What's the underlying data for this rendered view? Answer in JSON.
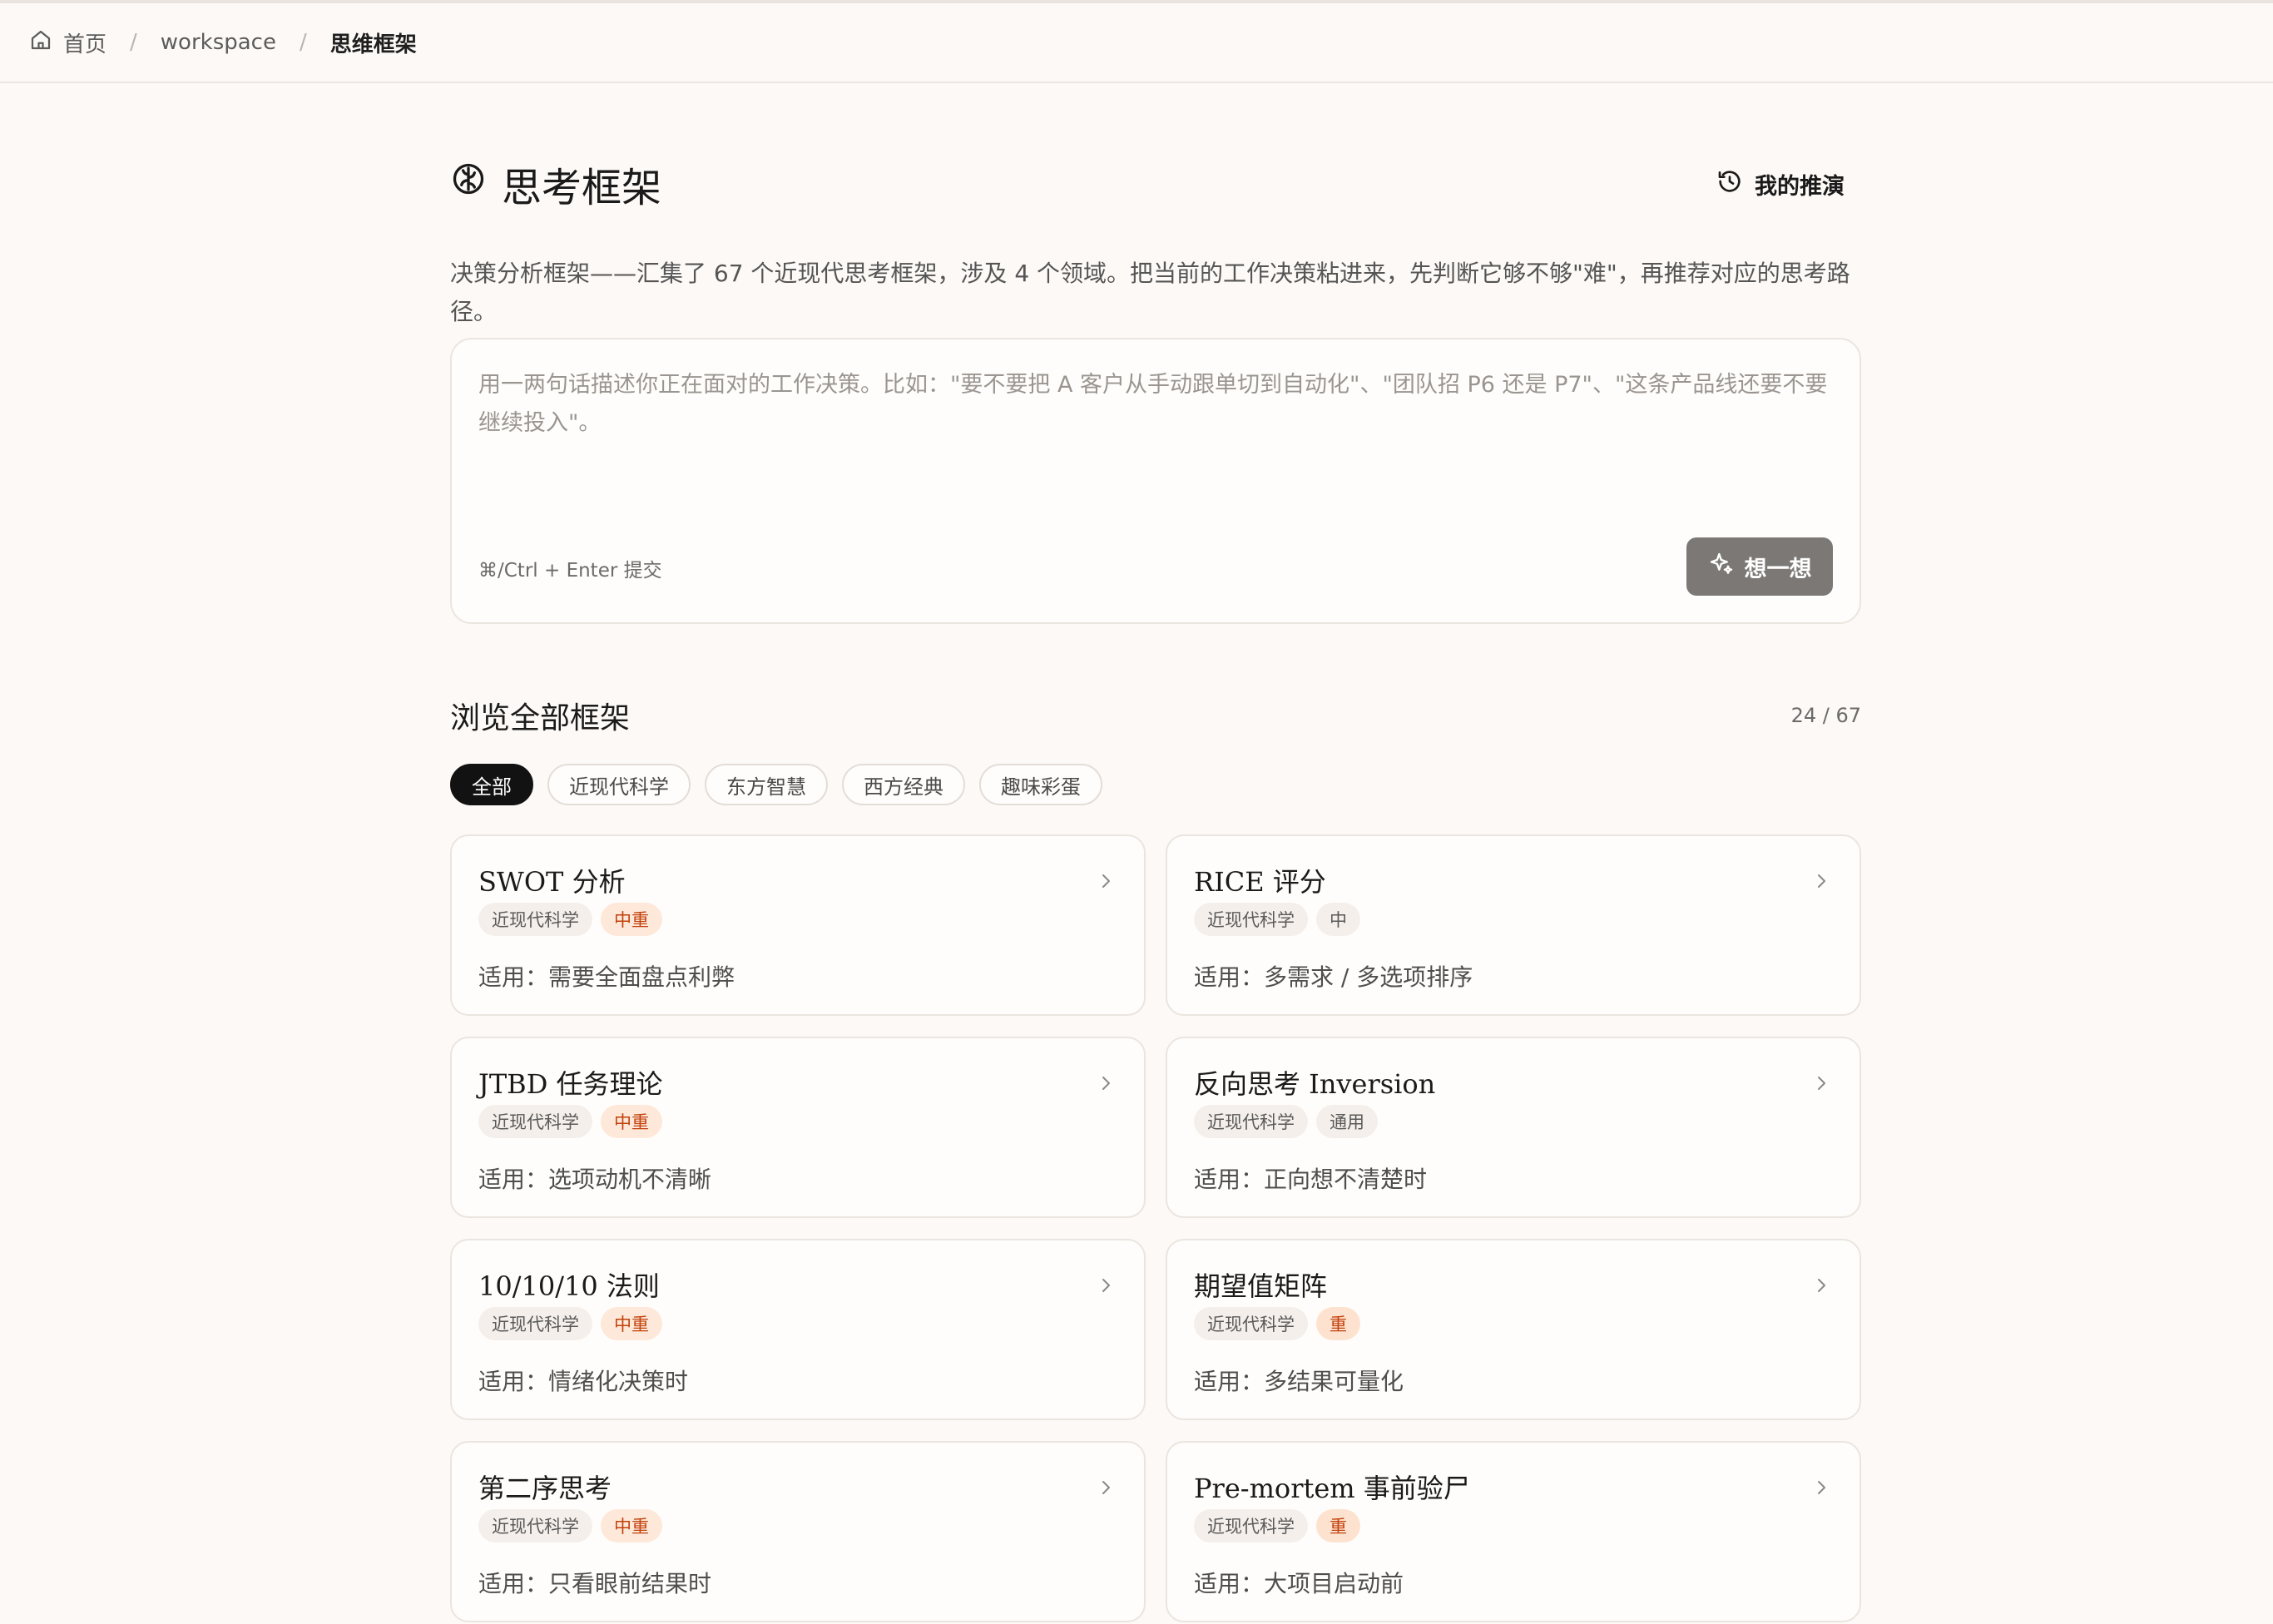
{
  "breadcrumb": {
    "items": [
      {
        "label": "首页",
        "icon": "home-icon"
      },
      {
        "label": "workspace"
      },
      {
        "label": "思维框架"
      }
    ],
    "separator": "/"
  },
  "header": {
    "title": "思考框架",
    "title_icon": "brain-icon",
    "history_label": "我的推演",
    "history_icon": "history-icon"
  },
  "description": "决策分析框架——汇集了 67 个近现代思考框架，涉及 4 个领域。把当前的工作决策粘进来，先判断它够不够\"难\"，再推荐对应的思考路径。",
  "input": {
    "placeholder": "用一两句话描述你正在面对的工作决策。比如：\"要不要把 A 客户从手动跟单切到自动化\"、\"团队招 P6 还是 P7\"、\"这条产品线还要不要继续投入\"。",
    "value": "",
    "hint": "⌘/Ctrl + Enter 提交",
    "submit_label": "想一想",
    "submit_icon": "sparkle-icon"
  },
  "browse": {
    "title": "浏览全部框架",
    "count": "24 / 67",
    "filters": [
      "全部",
      "近现代科学",
      "东方智慧",
      "西方经典",
      "趣味彩蛋"
    ],
    "active_filter": "全部"
  },
  "frameworks": [
    {
      "name": "SWOT 分析",
      "category": "近现代科学",
      "weight": "中重",
      "weight_style": "w-mid",
      "applies": "适用：需要全面盘点利弊"
    },
    {
      "name": "RICE 评分",
      "category": "近现代科学",
      "weight": "中",
      "weight_style": "w-light",
      "applies": "适用：多需求 / 多选项排序"
    },
    {
      "name": "JTBD 任务理论",
      "category": "近现代科学",
      "weight": "中重",
      "weight_style": "w-mid",
      "applies": "适用：选项动机不清晰"
    },
    {
      "name": "反向思考 Inversion",
      "category": "近现代科学",
      "weight": "通用",
      "weight_style": "w-light",
      "applies": "适用：正向想不清楚时"
    },
    {
      "name": "10/10/10 法则",
      "category": "近现代科学",
      "weight": "中重",
      "weight_style": "w-mid",
      "applies": "适用：情绪化决策时"
    },
    {
      "name": "期望值矩阵",
      "category": "近现代科学",
      "weight": "重",
      "weight_style": "w-heavy",
      "applies": "适用：多结果可量化"
    },
    {
      "name": "第二序思考",
      "category": "近现代科学",
      "weight": "中重",
      "weight_style": "w-mid",
      "applies": "适用：只看眼前结果时"
    },
    {
      "name": "Pre-mortem 事前验尸",
      "category": "近现代科学",
      "weight": "重",
      "weight_style": "w-heavy",
      "applies": "适用：大项目启动前"
    }
  ],
  "colors": {
    "background": "#fdf9f6",
    "accent_dark": "#121212",
    "submit_button": "#7b7876",
    "weight_tag_text": "#c2410c",
    "weight_tag_bg": "#fde8d9"
  }
}
